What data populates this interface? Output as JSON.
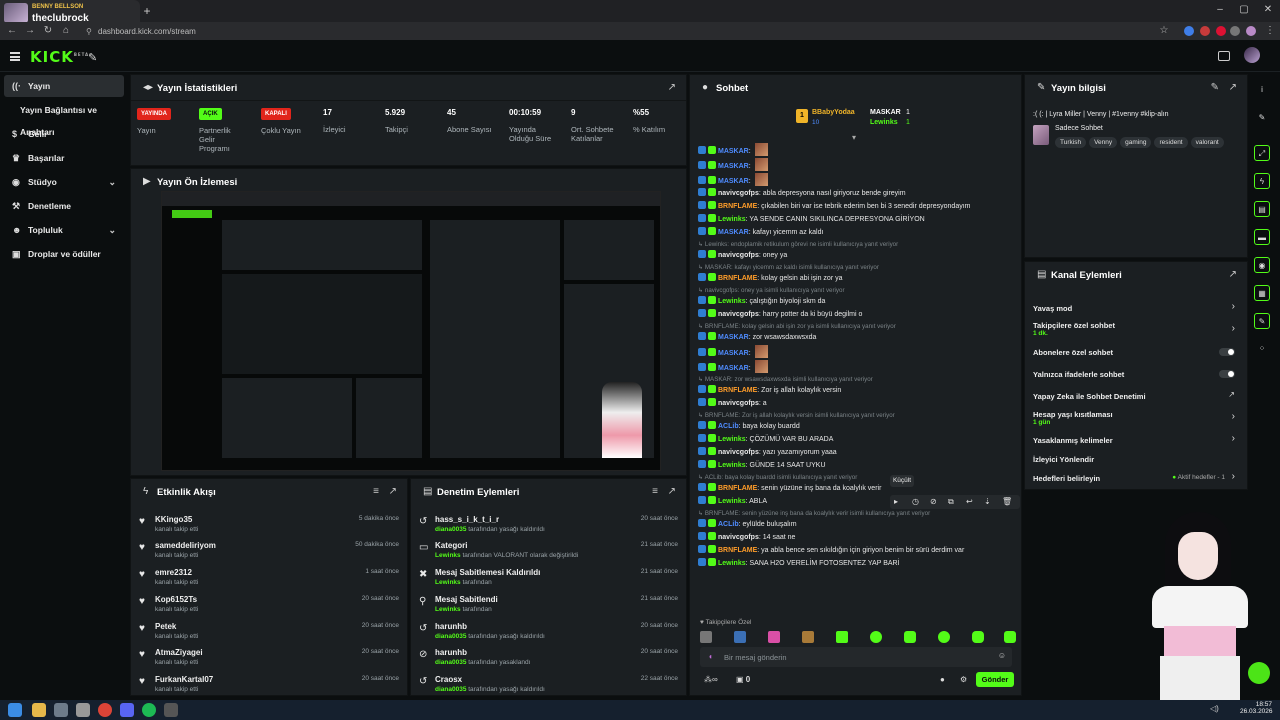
{
  "browser": {
    "tab_small": "BENNY BELLSON",
    "tab_title": "theclubrock",
    "url": "dashboard.kick.com/stream"
  },
  "sidebar": {
    "items": [
      {
        "label": "Yayın",
        "icon": "broadcast-icon"
      },
      {
        "label": "Yayın Bağlantısı ve Anahtarı",
        "icon": ""
      },
      {
        "label": "Gelir",
        "icon": "dollar-icon"
      },
      {
        "label": "Başarılar",
        "icon": "trophy-icon"
      },
      {
        "label": "Stüdyo",
        "icon": "palette-icon"
      },
      {
        "label": "Denetleme",
        "icon": "gavel-icon"
      },
      {
        "label": "Topluluk",
        "icon": "people-icon"
      },
      {
        "label": "Droplar ve ödüller",
        "icon": "gift-icon"
      }
    ]
  },
  "stats": {
    "title": "Yayın İstatistikleri",
    "items": [
      {
        "value": "YAYINDA",
        "label": "Yayın",
        "kind": "red"
      },
      {
        "value": "AÇIK",
        "label": "Partnerlik Gelir Programı",
        "kind": "green"
      },
      {
        "value": "KAPALI",
        "label": "Çoklu Yayın",
        "kind": "red"
      },
      {
        "value": "17",
        "label": "İzleyici",
        "kind": "num"
      },
      {
        "value": "5.929",
        "label": "Takipçi",
        "kind": "num"
      },
      {
        "value": "45",
        "label": "Abone Sayısı",
        "kind": "num"
      },
      {
        "value": "00:10:59",
        "label": "Yayında Olduğu Süre",
        "kind": "num"
      },
      {
        "value": "9",
        "label": "Ort. Sohbete Katılanlar",
        "kind": "num"
      },
      {
        "value": "%55",
        "label": "% Katılım",
        "kind": "num"
      }
    ]
  },
  "preview": {
    "title": "Yayın Ön İzlemesi"
  },
  "activity": {
    "title": "Etkinlik Akışı",
    "rows": [
      {
        "name": "KKingo35",
        "sub": "kanalı takip etti",
        "time": "5 dakika önce"
      },
      {
        "name": "sameddeliriyom",
        "sub": "kanalı takip etti",
        "time": "50 dakika önce"
      },
      {
        "name": "emre2312",
        "sub": "kanalı takip etti",
        "time": "1 saat önce"
      },
      {
        "name": "Kop6152Ts",
        "sub": "kanalı takip etti",
        "time": "20 saat önce"
      },
      {
        "name": "Petek",
        "sub": "kanalı takip etti",
        "time": "20 saat önce"
      },
      {
        "name": "AtmaZiyagei",
        "sub": "kanalı takip etti",
        "time": "20 saat önce"
      },
      {
        "name": "FurkanKartal07",
        "sub": "kanalı takip etti",
        "time": "20 saat önce"
      }
    ]
  },
  "moderation": {
    "title": "Denetim Eylemleri",
    "rows": [
      {
        "name": "hass_s_i_k_t_i_r",
        "actor": "diana0035",
        "sub": "tarafından yasağı kaldırıldı",
        "time": "20 saat önce"
      },
      {
        "name": "Kategori",
        "actor": "Lewinks",
        "sub": "tarafından VALORANT olarak değiştirildi",
        "time": "21 saat önce"
      },
      {
        "name": "Mesaj Sabitlemesi Kaldırıldı",
        "actor": "Lewinks",
        "sub": "tarafından",
        "time": "21 saat önce"
      },
      {
        "name": "Mesaj Sabitlendi",
        "actor": "Lewinks",
        "sub": "tarafından",
        "time": "21 saat önce"
      },
      {
        "name": "harunhb",
        "actor": "diana0035",
        "sub": "tarafından yasağı kaldırıldı",
        "time": "20 saat önce"
      },
      {
        "name": "harunhb",
        "actor": "diana0035",
        "sub": "tarafından yasaklandı",
        "time": "20 saat önce"
      },
      {
        "name": "Craosx",
        "actor": "diana0035",
        "sub": "tarafından yasağı kaldırıldı",
        "time": "22 saat önce"
      }
    ]
  },
  "chat": {
    "title": "Sohbet",
    "leaders": [
      {
        "name": "BBabyYodaa",
        "count": "10"
      },
      {
        "name": "MASKAR",
        "count": "1"
      },
      {
        "name": "Lewinks",
        "count": "1"
      }
    ],
    "messages": [
      {
        "user": "MASKAR",
        "text": "",
        "color": "#4f8cff",
        "reply": false
      },
      {
        "user": "MASKAR",
        "text": "",
        "color": "#4f8cff",
        "reply": false
      },
      {
        "user": "MASKAR",
        "text": "",
        "color": "#4f8cff",
        "reply": false
      },
      {
        "user": "navivcgofps",
        "text": "abla depresyona nasıl giriyoruz bende gireyim",
        "color": "#e8e8e8",
        "reply": false
      },
      {
        "user": "BRNFLAME",
        "text": "çıkabilen biri var ise tebrik ederim ben bi 3 senedir depresyondayım",
        "color": "#ff9d2a",
        "reply": false
      },
      {
        "user": "Lewinks",
        "text": "YA SENDE CANIN SIKILINCA DEPRESYONA GİRİYON",
        "color": "#53fc18",
        "reply": false
      },
      {
        "user": "MASKAR",
        "text": "kafayı yicemm az kaldı",
        "color": "#4f8cff",
        "reply": false
      },
      {
        "user": "",
        "text": "Lewinks: endoplamik retikulum görevi ne isimli kullanıcıya yanıt veriyor",
        "color": "",
        "reply": true
      },
      {
        "user": "navivcgofps",
        "text": "oney ya",
        "color": "#e8e8e8",
        "reply": false
      },
      {
        "user": "",
        "text": "MASKAR: kafayı yicemm az kaldı isimli kullanıcıya yanıt veriyor",
        "color": "",
        "reply": true
      },
      {
        "user": "BRNFLAME",
        "text": "kolay gelsin abi işin zor ya",
        "color": "#ff9d2a",
        "reply": false
      },
      {
        "user": "",
        "text": "navivcgofps: oney ya isimli kullanıcıya yanıt veriyor",
        "color": "",
        "reply": true
      },
      {
        "user": "Lewinks",
        "text": "çalıştığın biyoloji skm da",
        "color": "#53fc18",
        "reply": false
      },
      {
        "user": "navivcgofps",
        "text": "harry potter da ki büyü degilmi o",
        "color": "#e8e8e8",
        "reply": false
      },
      {
        "user": "",
        "text": "BRNFLAME: kolay gelsin abi işin zor ya isimli kullanıcıya yanıt veriyor",
        "color": "",
        "reply": true
      },
      {
        "user": "MASKAR",
        "text": "zor wsawsdaxwsxda",
        "color": "#4f8cff",
        "reply": false
      },
      {
        "user": "MASKAR",
        "text": "",
        "color": "#4f8cff",
        "reply": false
      },
      {
        "user": "MASKAR",
        "text": "",
        "color": "#4f8cff",
        "reply": false
      },
      {
        "user": "",
        "text": "MASKAR: zor wsawsdaxwsxda isimli kullanıcıya yanıt veriyor",
        "color": "",
        "reply": true
      },
      {
        "user": "BRNFLAME",
        "text": "Zor iş allah kolaylık versin",
        "color": "#ff9d2a",
        "reply": false
      },
      {
        "user": "navivcgofps",
        "text": "a",
        "color": "#e8e8e8",
        "reply": false
      },
      {
        "user": "",
        "text": "BRNFLAME: Zor iş allah kolaylık versin isimli kullanıcıya yanıt veriyor",
        "color": "",
        "reply": true
      },
      {
        "user": "ACLib",
        "text": "baya kolay buardd",
        "color": "#4f8cff",
        "reply": false
      },
      {
        "user": "Lewinks",
        "text": "ÇÖZÜMÜ VAR BU ARADA",
        "color": "#53fc18",
        "reply": false
      },
      {
        "user": "navivcgofps",
        "text": "yazı yazamıyorum yaaa",
        "color": "#e8e8e8",
        "reply": false
      },
      {
        "user": "Lewinks",
        "text": "GÜNDE 14 SAAT UYKU",
        "color": "#53fc18",
        "reply": false
      },
      {
        "user": "",
        "text": "ACLib: baya kolay buardd isimli kullanıcıya yanıt veriyor",
        "color": "",
        "reply": true
      },
      {
        "user": "BRNFLAME",
        "text": "senin yüzüne inş bana da koalylık verir",
        "color": "#ff9d2a",
        "reply": false
      },
      {
        "user": "Lewinks",
        "text": "ABLA",
        "color": "#53fc18",
        "reply": false
      },
      {
        "user": "",
        "text": "BRNFLAME: senin yüzüne inş bana da koalylık verir isimli kullanıcıya yanıt veriyor",
        "color": "",
        "reply": true
      },
      {
        "user": "ACLib",
        "text": "eylülde buluşalım",
        "color": "#4f8cff",
        "reply": false
      },
      {
        "user": "navivcgofps",
        "text": "14 saat ne",
        "color": "#e8e8e8",
        "reply": false
      },
      {
        "user": "BRNFLAME",
        "text": "ya abla bence sen sıkıldığın için giriyon benim bir sürü derdim var",
        "color": "#ff9d2a",
        "reply": false
      },
      {
        "user": "Lewinks",
        "text": "SANA H2O VERELİM FOTOSENTEZ YAP BARİ",
        "color": "#53fc18",
        "reply": false
      }
    ],
    "tooltip": "Küçült",
    "followers_only": "Takipçilere Özel",
    "input_placeholder": "Bir mesaj gönderin",
    "send_label": "Gönder",
    "bottom_count": "0"
  },
  "streaminfo": {
    "title": "Yayın bilgisi",
    "stream_title": ":( (: | Lyra Miller | Venny | #1venny #klip-alın",
    "category": "Sadece Sohbet",
    "tags": [
      "Turkish",
      "Venny",
      "gaming",
      "resident",
      "valorant"
    ]
  },
  "channel_actions": {
    "title": "Kanal Eylemleri",
    "items": [
      {
        "label": "Yavaş mod",
        "sub": "",
        "ctrl": "chev"
      },
      {
        "label": "Takipçilere özel sohbet",
        "sub": "1 dk.",
        "ctrl": "chev"
      },
      {
        "label": "Abonelere özel sohbet",
        "sub": "",
        "ctrl": "toggle"
      },
      {
        "label": "Yalnızca ifadelerle sohbet",
        "sub": "",
        "ctrl": "toggle"
      },
      {
        "label": "Yapay Zeka ile Sohbet Denetimi",
        "sub": "",
        "ctrl": "ext"
      },
      {
        "label": "Hesap yaşı kısıtlaması",
        "sub": "1 gün",
        "ctrl": "chev"
      },
      {
        "label": "Yasaklanmış kelimeler",
        "sub": "",
        "ctrl": "chev"
      },
      {
        "label": "İzleyici Yönlendir",
        "sub": "",
        "ctrl": ""
      },
      {
        "label": "Hedefleri belirleyin",
        "sub": "",
        "ctrl": "goal"
      }
    ],
    "goal_text": "Aktif hedefler - 1"
  },
  "taskbar": {
    "time": "18:57",
    "date": "26.03.2026"
  },
  "colors": {
    "accent": "#53fc18",
    "live": "#e1251b",
    "panel": "#1b1f22"
  }
}
